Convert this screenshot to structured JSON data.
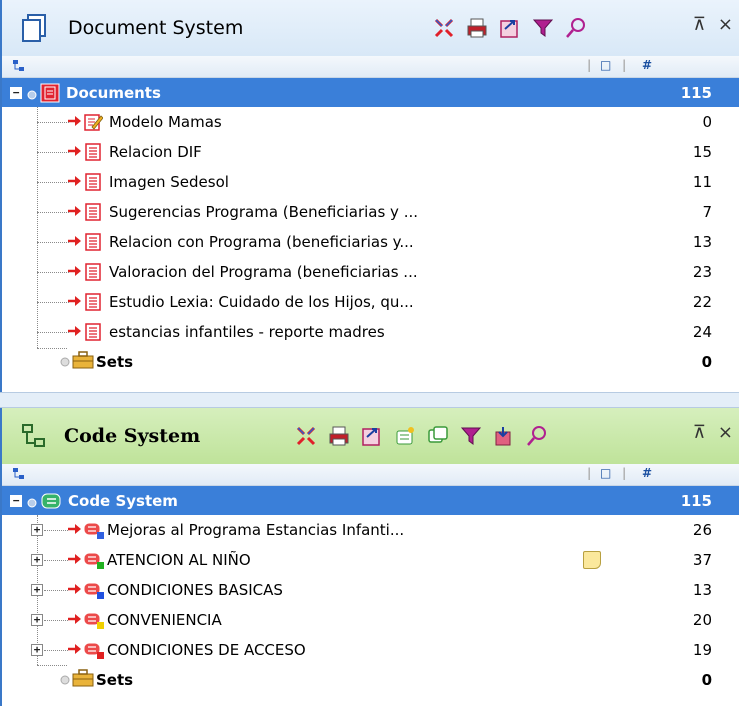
{
  "document_panel": {
    "title": "Document System",
    "close_glyph": "×",
    "pin_glyph": "⊼",
    "header": {
      "col_memo": "□",
      "col_count": "#"
    },
    "root": {
      "label": "Documents",
      "count": "115"
    },
    "items": [
      {
        "label": "Modelo Mamas",
        "count": "0",
        "icon": "text-doc-edit-icon"
      },
      {
        "label": "Relacion DIF",
        "count": "15",
        "icon": "text-doc-icon"
      },
      {
        "label": "Imagen Sedesol",
        "count": "11",
        "icon": "text-doc-icon"
      },
      {
        "label": "Sugerencias Programa (Beneficiarias y ...",
        "count": "7",
        "icon": "text-doc-icon"
      },
      {
        "label": "Relacion con Programa (beneficiarias y...",
        "count": "13",
        "icon": "text-doc-icon"
      },
      {
        "label": "Valoracion del Programa (beneficiarias ...",
        "count": "23",
        "icon": "text-doc-icon"
      },
      {
        "label": "Estudio Lexia: Cuidado de los Hijos, qu...",
        "count": "22",
        "icon": "text-doc-icon"
      },
      {
        "label": "estancias infantiles - reporte madres",
        "count": "24",
        "icon": "text-doc-icon"
      }
    ],
    "sets": {
      "label": "Sets",
      "count": "0"
    }
  },
  "code_panel": {
    "title": "Code System",
    "close_glyph": "×",
    "pin_glyph": "⊼",
    "header": {
      "col_memo": "□",
      "col_count": "#"
    },
    "root": {
      "label": "Code System",
      "count": "115"
    },
    "items": [
      {
        "label": "Mejoras al Programa Estancias Infanti...",
        "count": "26",
        "color": "#3060e0"
      },
      {
        "label": "ATENCION AL NIÑO",
        "count": "37",
        "color": "#20b020",
        "memo": true
      },
      {
        "label": "CONDICIONES BASICAS",
        "count": "13",
        "color": "#2050e0"
      },
      {
        "label": "CONVENIENCIA",
        "count": "20",
        "color": "#f0d000"
      },
      {
        "label": "CONDICIONES DE ACCESO",
        "count": "19",
        "color": "#e02020"
      }
    ],
    "sets": {
      "label": "Sets",
      "count": "0"
    }
  },
  "colors": {
    "selection": "#3a7fd9",
    "doc_title_bar": "#d8e8f7",
    "code_title_bar": "#bfe39a",
    "link_arrow": "#e02020",
    "doc_icon": "#e02020"
  }
}
